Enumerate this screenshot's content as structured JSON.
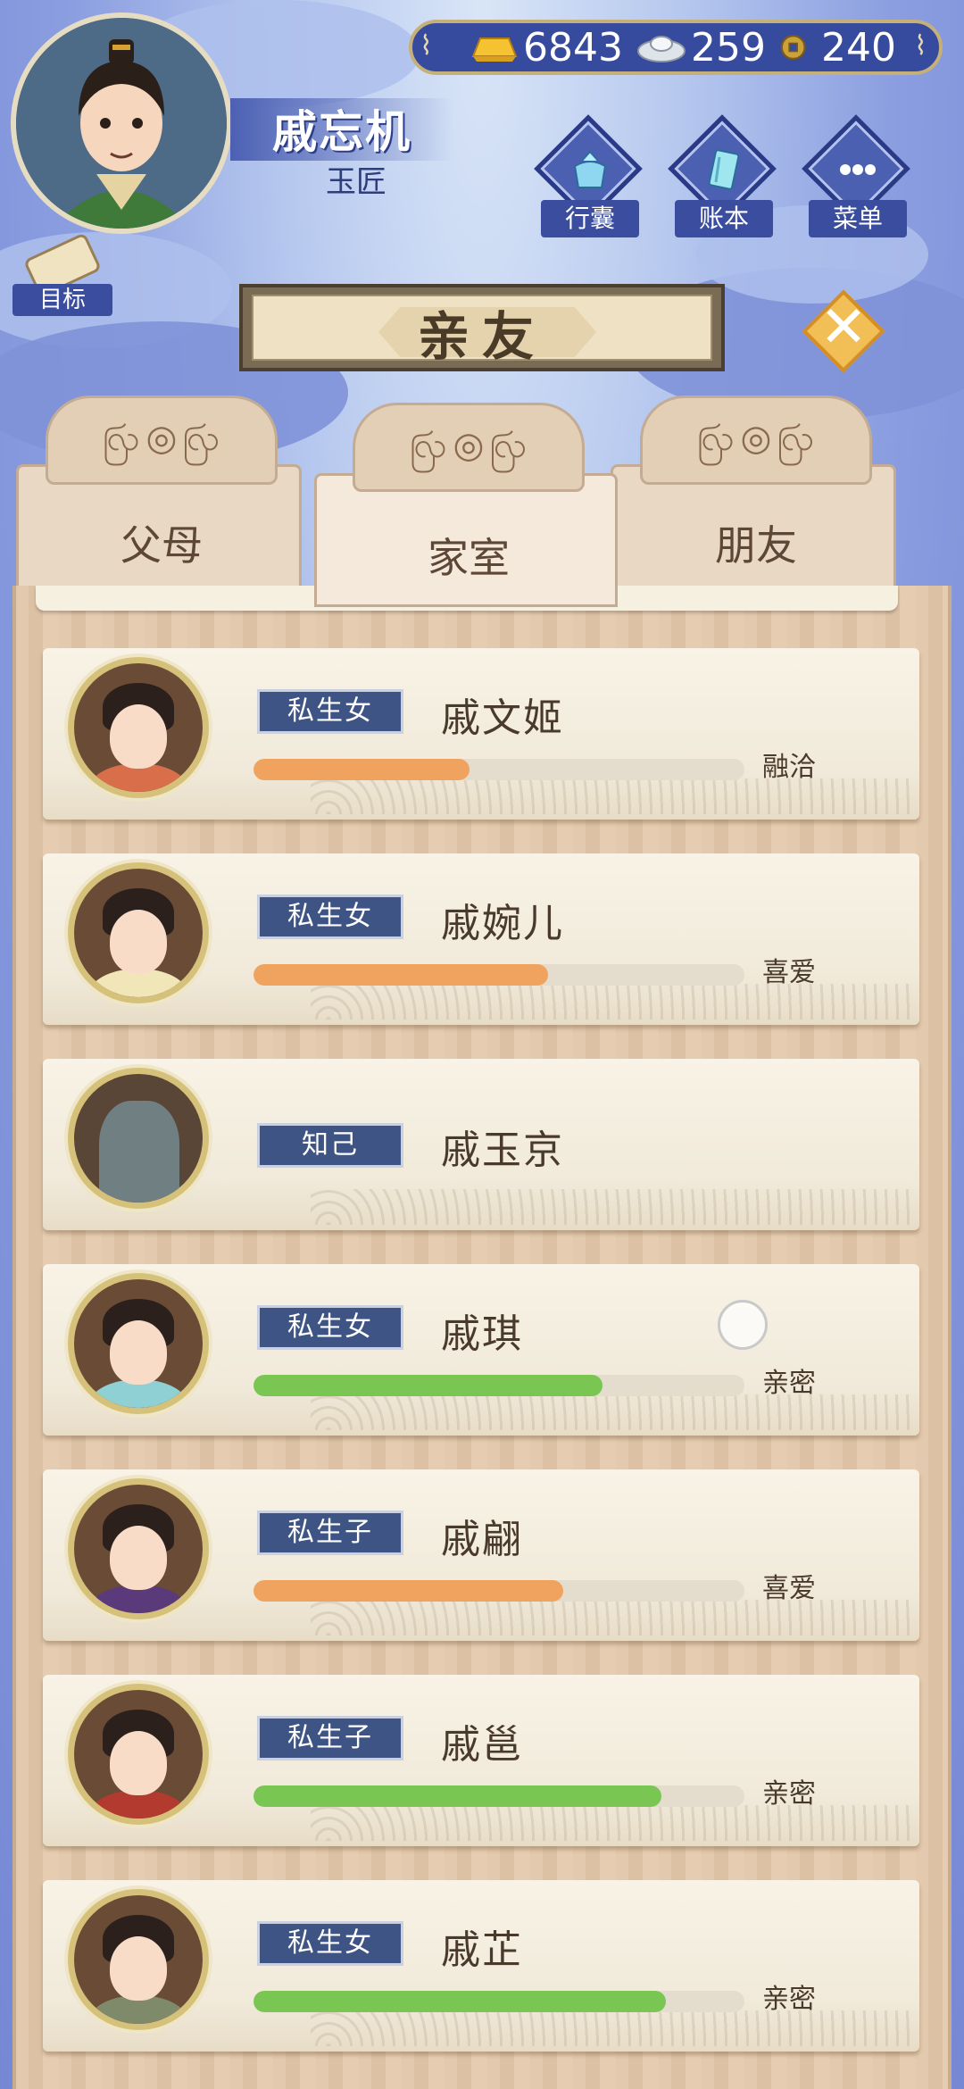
{
  "currency": [
    {
      "name": "gold-ingot-icon",
      "value": "6843"
    },
    {
      "name": "silver-ingot-icon",
      "value": "259"
    },
    {
      "name": "copper-coin-icon",
      "value": "240"
    }
  ],
  "player": {
    "name": "戚忘机",
    "title": "玉匠"
  },
  "menu": [
    {
      "label": "行囊",
      "icon": "bundle-icon"
    },
    {
      "label": "账本",
      "icon": "ledger-icon"
    },
    {
      "label": "菜单",
      "icon": "more-dots-icon"
    }
  ],
  "goal": {
    "label": "目标",
    "icon": "scroll-icon"
  },
  "page_title": "亲友",
  "tabs": [
    {
      "label": "父母",
      "active": false
    },
    {
      "label": "家室",
      "active": true
    },
    {
      "label": "朋友",
      "active": false
    }
  ],
  "colors": {
    "orange_bar": "#f0a35e",
    "green_bar": "#79c653",
    "tag_bg": "#3e5484"
  },
  "relatives": [
    {
      "relation": "私生女",
      "name": "戚文姬",
      "status": "融洽",
      "affinity": 0.44,
      "bar_color": "#f0a35e"
    },
    {
      "relation": "私生女",
      "name": "戚婉儿",
      "status": "喜爱",
      "affinity": 0.6,
      "bar_color": "#f0a35e"
    },
    {
      "relation": "知己",
      "name": "戚玉京",
      "status": "",
      "affinity": null,
      "bar_color": ""
    },
    {
      "relation": "私生女",
      "name": "戚琪",
      "status": "亲密",
      "affinity": 0.71,
      "bar_color": "#79c653"
    },
    {
      "relation": "私生子",
      "name": "戚翩",
      "status": "喜爱",
      "affinity": 0.63,
      "bar_color": "#f0a35e"
    },
    {
      "relation": "私生子",
      "name": "戚邕",
      "status": "亲密",
      "affinity": 0.83,
      "bar_color": "#79c653"
    },
    {
      "relation": "私生女",
      "name": "戚芷",
      "status": "亲密",
      "affinity": 0.84,
      "bar_color": "#79c653"
    }
  ]
}
